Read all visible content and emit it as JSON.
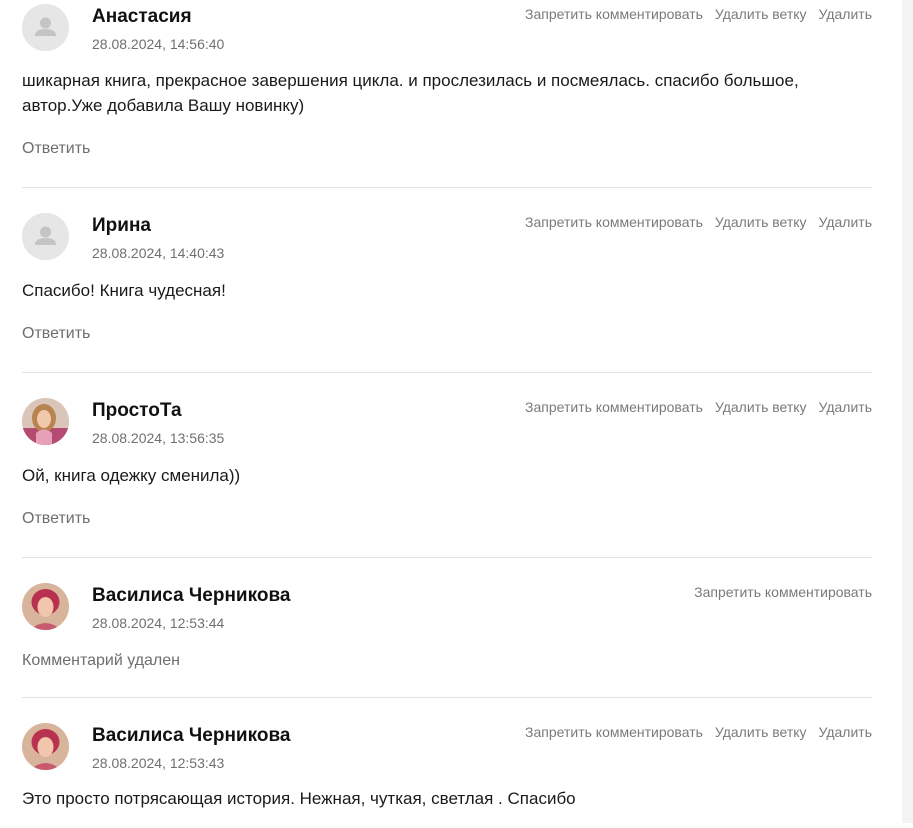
{
  "actions": {
    "ban": "Запретить комментировать",
    "delete_branch": "Удалить ветку",
    "delete": "Удалить"
  },
  "reply_label": "Ответить",
  "comments": [
    {
      "author": "Анастасия",
      "date": "28.08.2024, 14:56:40",
      "text": "шикарная книга, прекрасное завершения цикла. и прослезилась и посмеялась. спасибо большое, автор.Уже добавила Вашу новинку)",
      "avatar": "default-avatar-icon"
    },
    {
      "author": "Ирина",
      "date": "28.08.2024, 14:40:43",
      "text": "Спасибо! Книга чудесная!",
      "avatar": "default-avatar-icon"
    },
    {
      "author": "ПростоТа",
      "date": "28.08.2024, 13:56:35",
      "text": "Ой, книга одежку сменила))",
      "avatar": "user-photo"
    },
    {
      "author": "Василиса Черникова",
      "date": "28.08.2024, 12:53:44",
      "text": "Комментарий удален",
      "avatar": "user-photo"
    },
    {
      "author": "Василиса Черникова",
      "date": "28.08.2024, 12:53:43",
      "text": "Это просто потрясающая история. Нежная, чуткая, светлая . Спасибо",
      "avatar": "user-photo"
    }
  ]
}
